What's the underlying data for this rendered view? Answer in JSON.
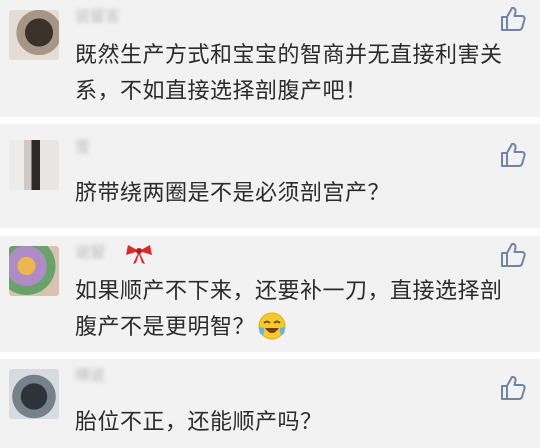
{
  "comments": [
    {
      "username": "说留言",
      "text": "既然生产方式和宝宝的智商并无直接利害关系，不如直接选择剖腹产吧！",
      "avatar": "avatar-photo",
      "icons": {
        "like": "thumbs-up-icon"
      }
    },
    {
      "username": "雪",
      "text": "脐带绕两圈是不是必须剖宫产？",
      "avatar": "avatar-photo",
      "icons": {
        "like": "thumbs-up-icon"
      }
    },
    {
      "username": "说留",
      "text": "如果顺产不下来，还要补一刀，直接选择剖腹产不是更明智？",
      "avatar": "avatar-photo",
      "icons": {
        "like": "thumbs-up-icon",
        "name_badge": "red-ribbon-icon",
        "emoji": "tears-of-joy-emoji-icon"
      }
    },
    {
      "username": "晴说",
      "text": "胎位不正，还能顺产吗？",
      "avatar": "avatar-photo",
      "icons": {
        "like": "thumbs-up-icon"
      }
    }
  ],
  "colors": {
    "card_background": "#f2f2f2",
    "separator": "#ffffff",
    "text": "#2b2b2b",
    "like_icon": "#6f84a9",
    "ribbon": "#d92b2b"
  }
}
